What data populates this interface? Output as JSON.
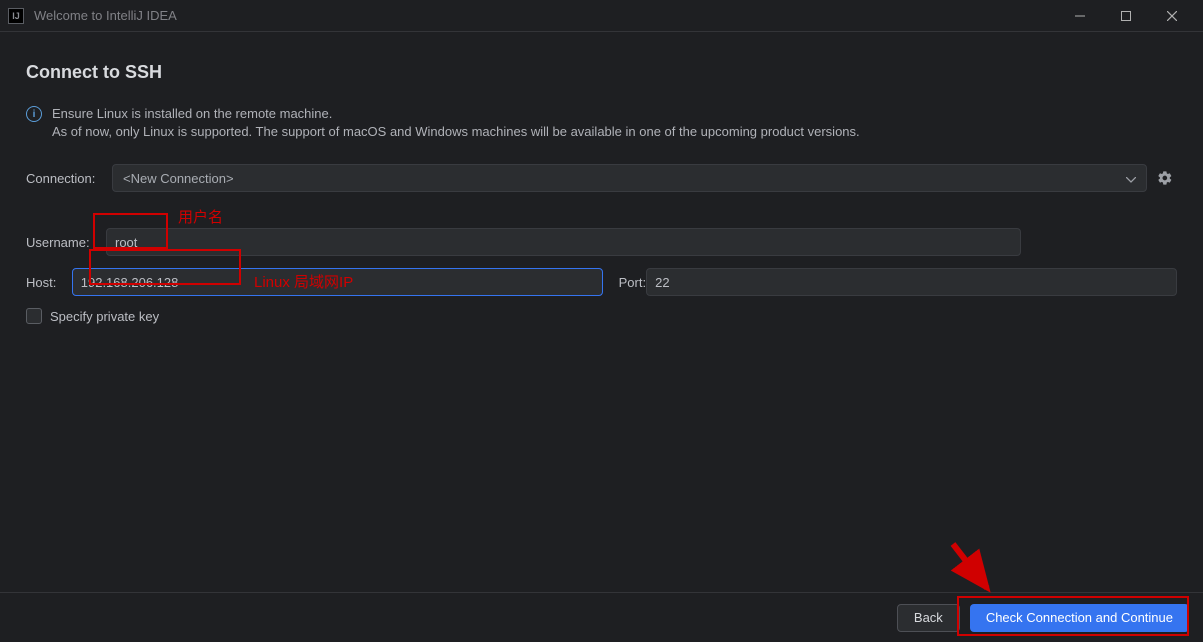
{
  "titlebar": {
    "appIconText": "IJ",
    "title": "Welcome to IntelliJ IDEA"
  },
  "heading": "Connect to SSH",
  "info": {
    "line1": "Ensure Linux is installed on the remote machine.",
    "line2": "As of now, only Linux is supported. The support of macOS and Windows machines will be available in one of the upcoming product versions."
  },
  "labels": {
    "connection": "Connection:",
    "username": "Username:",
    "host": "Host:",
    "port": "Port:",
    "specifyKey": "Specify private key"
  },
  "values": {
    "connectionSelected": "<New Connection>",
    "username": "root",
    "host": "192.168.206.128",
    "port": "22"
  },
  "buttons": {
    "back": "Back",
    "continue": "Check Connection and Continue"
  },
  "annotations": {
    "usernameLabel": "用户名",
    "hostLabel": "Linux 局域网IP"
  }
}
